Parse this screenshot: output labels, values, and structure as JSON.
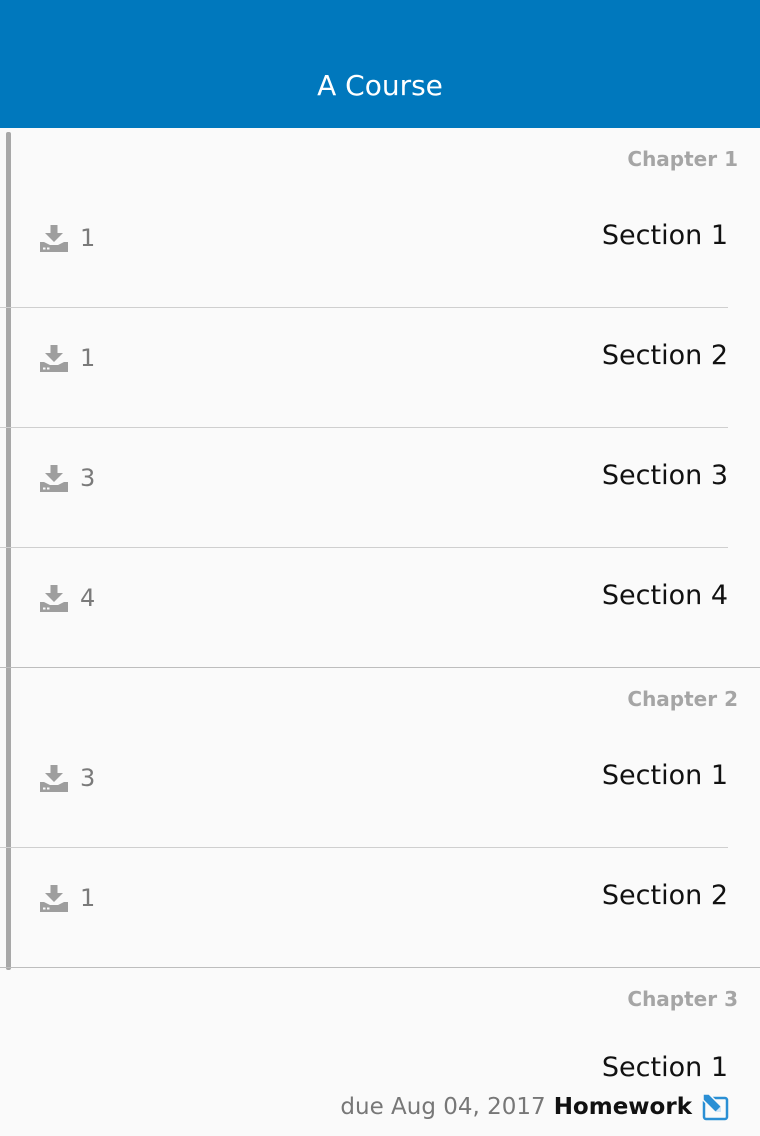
{
  "header": {
    "title": "A Course"
  },
  "chapters": [
    {
      "title": "Chapter 1",
      "sections": [
        {
          "name": "Section 1",
          "download_count": "1"
        },
        {
          "name": "Section 2",
          "download_count": "1"
        },
        {
          "name": "Section 3",
          "download_count": "3"
        },
        {
          "name": "Section 4",
          "download_count": "4"
        }
      ]
    },
    {
      "title": "Chapter 2",
      "sections": [
        {
          "name": "Section 1",
          "download_count": "3"
        },
        {
          "name": "Section 2",
          "download_count": "1"
        }
      ]
    },
    {
      "title": "Chapter 3",
      "sections": [
        {
          "name": "Section 1",
          "due": "due Aug 04, 2017",
          "assignment_type": "Homework",
          "icon": "homework-edit-icon"
        }
      ]
    }
  ],
  "icons": {
    "download": "download-icon",
    "homework": "homework-edit-icon"
  },
  "colors": {
    "appbar": "#0078bd",
    "background": "#fafafa",
    "chapter_text": "#a5a5a5",
    "icon_gray": "#9e9e9e",
    "accent": "#2a8fd4"
  }
}
